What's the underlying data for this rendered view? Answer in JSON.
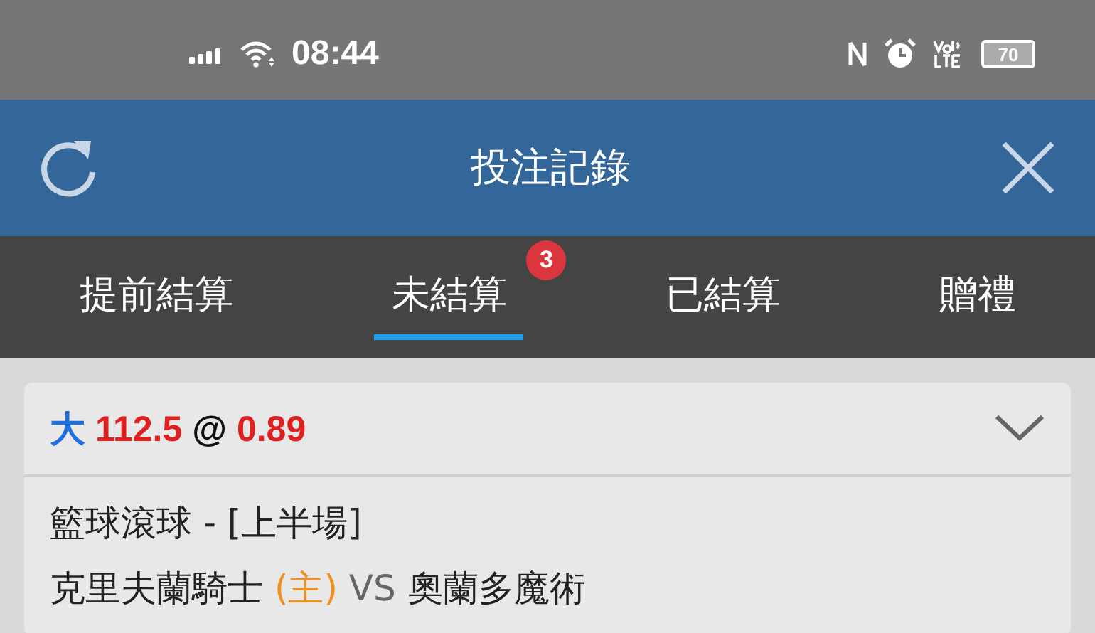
{
  "status_bar": {
    "time": "08:44",
    "battery": "70"
  },
  "header": {
    "title": "投注記錄"
  },
  "tabs": [
    {
      "label": "提前結算",
      "selected": false
    },
    {
      "label": "未結算",
      "selected": true,
      "badge": "3"
    },
    {
      "label": "已結算",
      "selected": false
    },
    {
      "label": "贈禮",
      "selected": false
    }
  ],
  "bet": {
    "selection": "大",
    "line": "112.5",
    "at": "@",
    "odds": "0.89",
    "competition": "籃球滾球 - [上半場]",
    "home": "克里夫蘭騎士",
    "home_tag": "(主)",
    "vs": "VS",
    "away": "奧蘭多魔術"
  }
}
